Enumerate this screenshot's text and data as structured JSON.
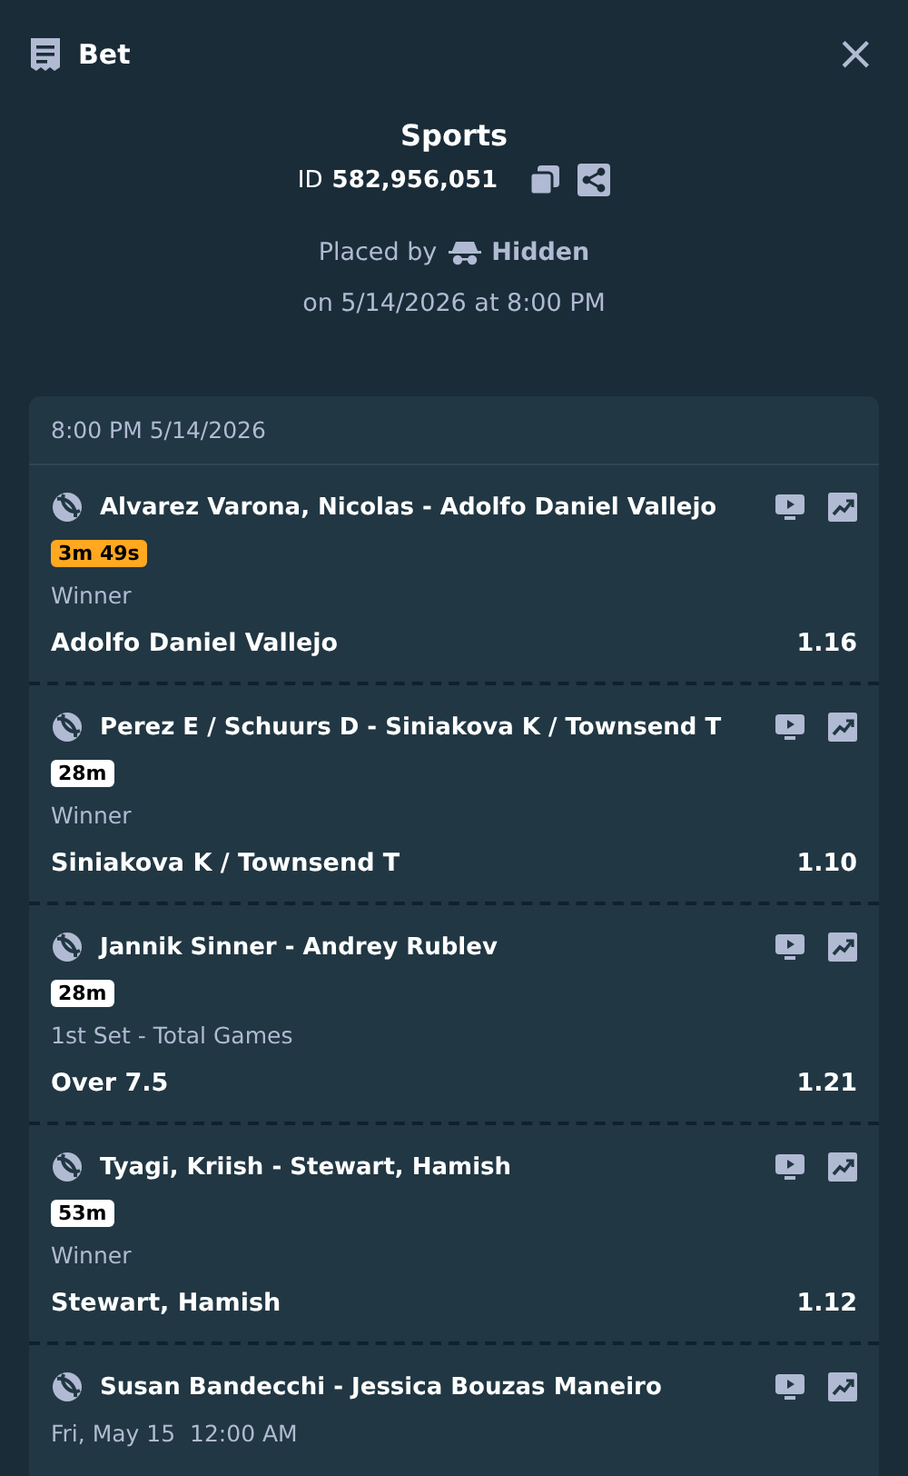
{
  "header": {
    "title": "Bet",
    "close": "×"
  },
  "summary": {
    "category": "Sports",
    "id_label": "ID",
    "id_value": "582,956,051",
    "placed_by_label": "Placed by",
    "placed_by_name": "Hidden",
    "placed_on": "on 5/14/2026 at 8:00 PM"
  },
  "card": {
    "date": "8:00 PM 5/14/2026",
    "legs": [
      {
        "event": "Alvarez Varona, Nicolas - Adolfo Daniel Vallejo",
        "start": {
          "kind": "badge",
          "text": "3m 49s",
          "color": "#ffa820"
        },
        "market": "Winner",
        "selection": "Adolfo Daniel Vallejo",
        "odds": "1.16"
      },
      {
        "event": "Perez E / Schuurs D - Siniakova K / Townsend T",
        "start": {
          "kind": "badge",
          "text": "28m",
          "color": "#ffffff"
        },
        "market": "Winner",
        "selection": "Siniakova K / Townsend T",
        "odds": "1.10"
      },
      {
        "event": "Jannik Sinner - Andrey Rublev",
        "start": {
          "kind": "badge",
          "text": "28m",
          "color": "#ffffff"
        },
        "market": "1st Set - Total Games",
        "selection": "Over 7.5",
        "odds": "1.21"
      },
      {
        "event": "Tyagi, Kriish - Stewart, Hamish",
        "start": {
          "kind": "badge",
          "text": "53m",
          "color": "#ffffff"
        },
        "market": "Winner",
        "selection": "Stewart, Hamish",
        "odds": "1.12"
      },
      {
        "event": "Susan Bandecchi - Jessica Bouzas Maneiro",
        "start": {
          "kind": "date",
          "text": "Fri, May 15  12:00 AM"
        }
      }
    ]
  }
}
